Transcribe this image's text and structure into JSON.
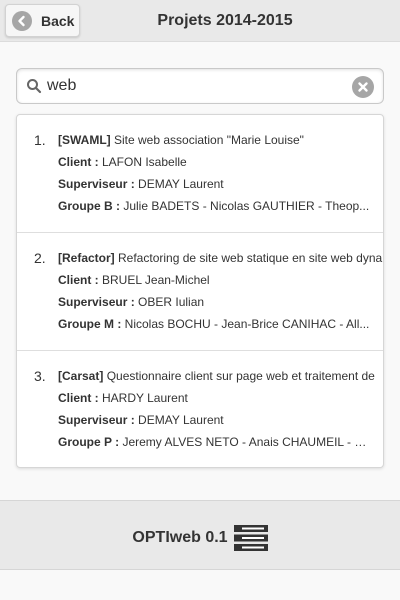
{
  "header": {
    "back_label": "Back",
    "title": "Projets 2014-2015"
  },
  "search": {
    "value": "web"
  },
  "results": [
    {
      "number": "1.",
      "tag": "[SWAML]",
      "title": " Site web association \"Marie Louise\"",
      "client_label": "Client :",
      "client": " LAFON Isabelle",
      "supervisor_label": "Superviseur :",
      "supervisor": " DEMAY Laurent",
      "group_label": "Groupe B :",
      "group": " Julie BADETS - Nicolas GAUTHIER - Theop..."
    },
    {
      "number": "2.",
      "tag": "[Refactor]",
      "title": " Refactoring de site web statique en site web dyna",
      "client_label": "Client :",
      "client": " BRUEL Jean-Michel",
      "supervisor_label": "Superviseur :",
      "supervisor": " OBER Iulian",
      "group_label": "Groupe M :",
      "group": " Nicolas BOCHU - Jean-Brice CANIHAC - All..."
    },
    {
      "number": "3.",
      "tag": "[Carsat]",
      "title": " Questionnaire client sur page web et traitement de",
      "client_label": "Client :",
      "client": " HARDY Laurent",
      "supervisor_label": "Superviseur :",
      "supervisor": " DEMAY Laurent",
      "group_label": "Groupe P :",
      "group": " Jeremy ALVES NETO - Anais CHAUMEIL - L..."
    }
  ],
  "footer": {
    "brand": "OPTIweb 0.1"
  }
}
